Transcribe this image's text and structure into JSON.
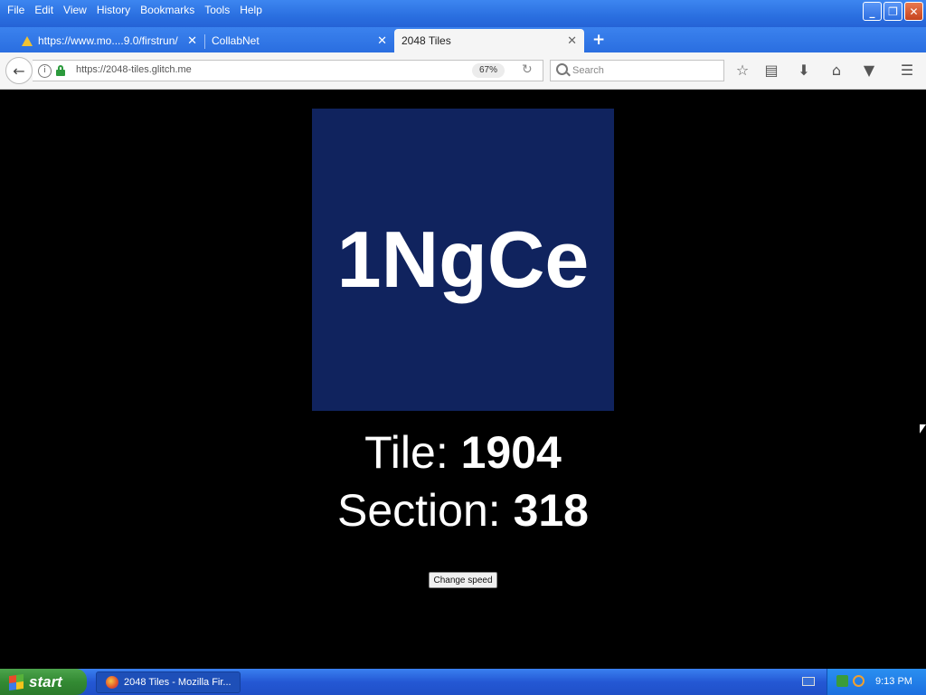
{
  "menu": [
    "File",
    "Edit",
    "View",
    "History",
    "Bookmarks",
    "Tools",
    "Help"
  ],
  "window_controls": {
    "minimize": "_",
    "restore": "❐",
    "close": "✕"
  },
  "tabs": [
    {
      "label": "https://www.mo....9.0/firstrun/",
      "close": "✕"
    },
    {
      "label": "CollabNet",
      "close": "✕"
    },
    {
      "label": "2048 Tiles",
      "close": "✕"
    }
  ],
  "new_tab": "+",
  "nav": {
    "url": "https://2048-tiles.glitch.me",
    "zoom": "67%",
    "search_placeholder": "Search"
  },
  "page": {
    "tile_text": "1NgCe",
    "tile_label": "Tile: ",
    "tile_value": "1904",
    "section_label": "Section: ",
    "section_value": "318",
    "button_label": "Change speed",
    "tile_color": "#10235e"
  },
  "taskbar": {
    "start_label": "start",
    "task_label": "2048 Tiles - Mozilla Fir...",
    "clock": "9:13 PM"
  }
}
